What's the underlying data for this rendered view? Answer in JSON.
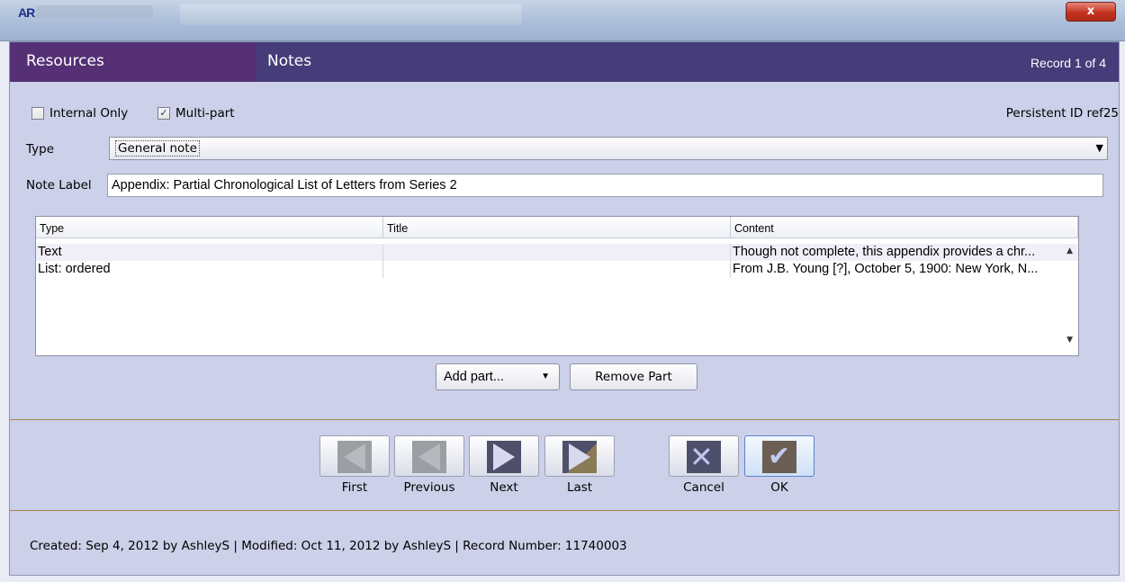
{
  "window": {
    "app_logo": "AR",
    "close_label": "x"
  },
  "header": {
    "section": "Resources",
    "title": "Notes",
    "record_counter": "Record 1 of 4"
  },
  "options": {
    "internal_only": {
      "label": "Internal Only",
      "checked": false
    },
    "multi_part": {
      "label": "Multi-part",
      "checked": true
    },
    "persistent_id": "Persistent ID  ref25"
  },
  "form": {
    "type_label": "Type",
    "type_value": "General note",
    "note_label_label": "Note Label",
    "note_label_value": "Appendix: Partial Chronological List of Letters from Series 2"
  },
  "parts_table": {
    "columns": [
      "Type",
      "Title",
      "Content"
    ],
    "rows": [
      {
        "type": "Text",
        "title": "",
        "content": "Though not complete, this appendix provides a chr..."
      },
      {
        "type": "List: ordered",
        "title": "",
        "content": "From J.B. Young [?], October 5, 1900: New York, N..."
      }
    ]
  },
  "part_buttons": {
    "add_part": "Add part...",
    "remove_part": "Remove Part"
  },
  "navigation": {
    "first": "First",
    "previous": "Previous",
    "next": "Next",
    "last": "Last",
    "cancel": "Cancel",
    "ok": "OK"
  },
  "status_bar": "Created: Sep 4, 2012 by AshleyS | Modified: Oct 11, 2012 by AshleyS | Record Number: 11740003",
  "colors": {
    "header_bg": "#453c79",
    "resources_tab_bg": "#553075",
    "panel_bg": "#ccd0e8",
    "separator": "#a8864e"
  },
  "icons": [
    "close-icon",
    "checkbox-icon",
    "dropdown-arrow-icon",
    "first-record-icon",
    "previous-record-icon",
    "next-record-icon",
    "last-record-icon",
    "cancel-icon",
    "ok-icon"
  ]
}
